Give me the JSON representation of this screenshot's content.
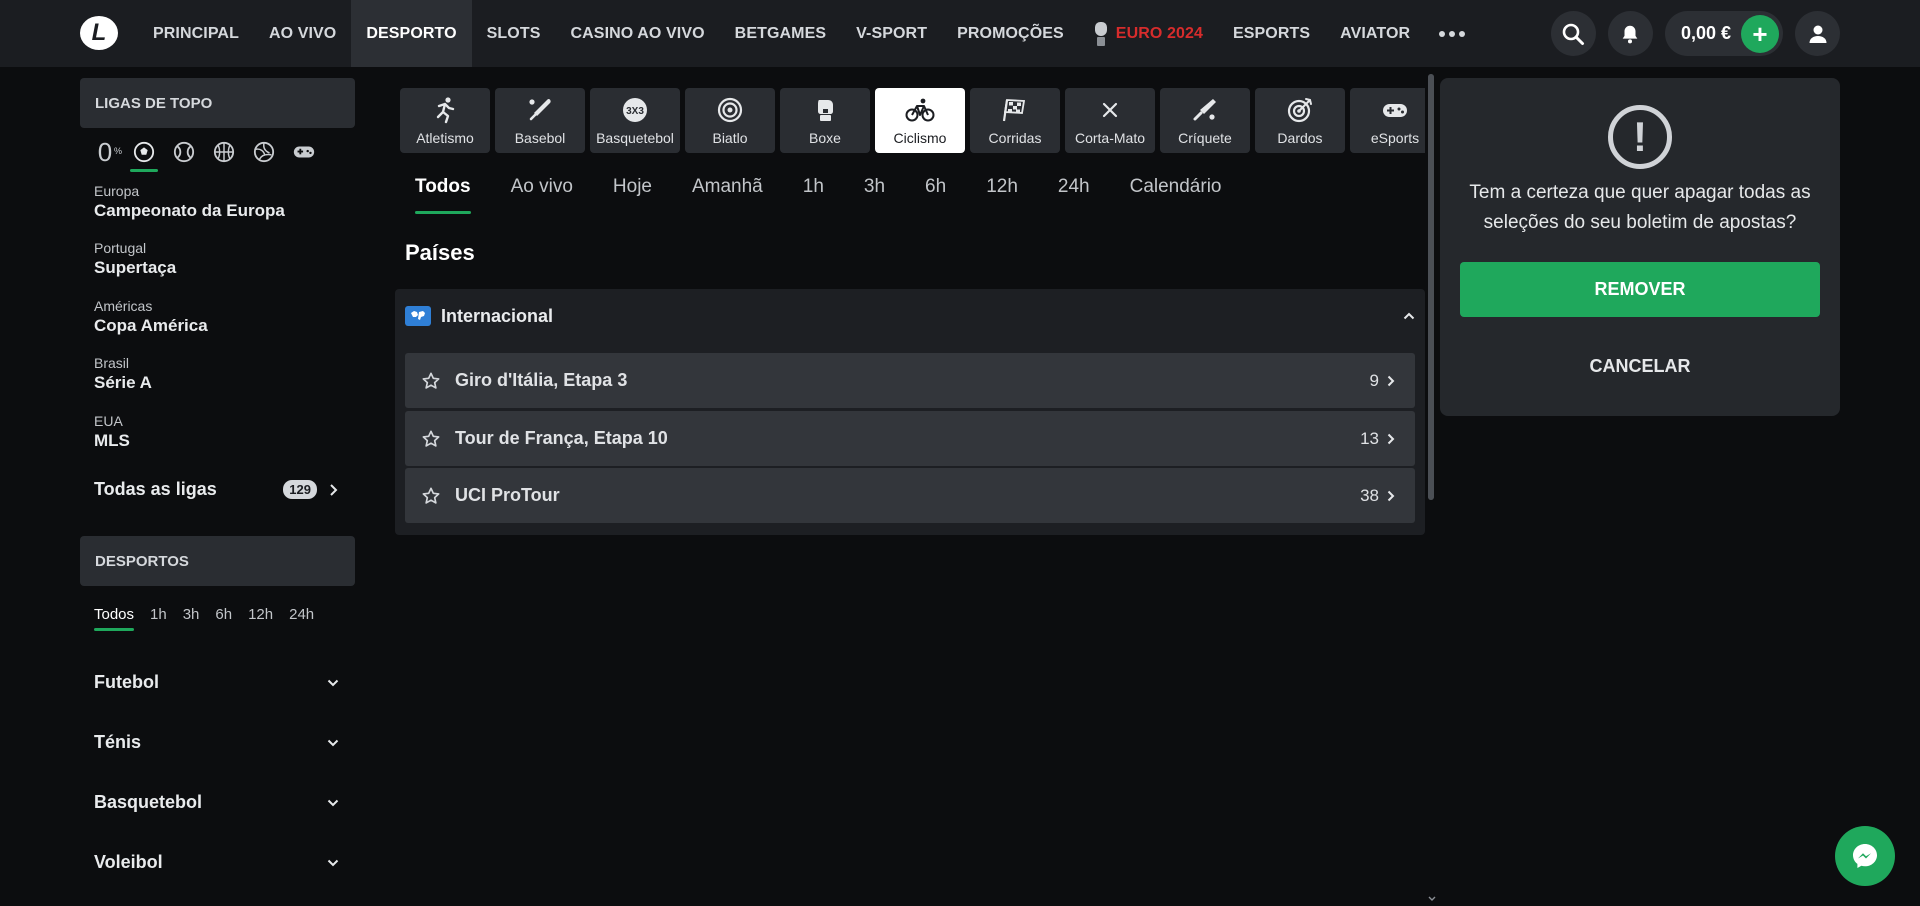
{
  "header": {
    "logo_letter": "L",
    "nav": [
      {
        "label": "PRINCIPAL"
      },
      {
        "label": "AO VIVO"
      },
      {
        "label": "DESPORTO",
        "active": true
      },
      {
        "label": "SLOTS"
      },
      {
        "label": "CASINO AO VIVO"
      },
      {
        "label": "BETGAMES"
      },
      {
        "label": "V-SPORT"
      },
      {
        "label": "PROMOÇÕES"
      },
      {
        "label": "EURO 2024",
        "color": "#d72c2c"
      },
      {
        "label": "ESPORTS"
      },
      {
        "label": "AVIATOR"
      }
    ],
    "balance": "0,00 €",
    "plus": "+"
  },
  "sidebar": {
    "top_leagues_title": "LIGAS DE TOPO",
    "zero_label": "0",
    "zero_sup": "%",
    "leagues": [
      {
        "region": "Europa",
        "name": "Campeonato da Europa"
      },
      {
        "region": "Portugal",
        "name": "Supertaça"
      },
      {
        "region": "Américas",
        "name": "Copa América"
      },
      {
        "region": "Brasil",
        "name": "Série A"
      },
      {
        "region": "EUA",
        "name": "MLS"
      }
    ],
    "all_leagues_label": "Todas as ligas",
    "all_leagues_count": "129",
    "sports_title": "DESPORTOS",
    "time_tabs": [
      "Todos",
      "1h",
      "3h",
      "6h",
      "12h",
      "24h"
    ],
    "sports": [
      "Futebol",
      "Ténis",
      "Basquetebol",
      "Voleibol"
    ]
  },
  "main": {
    "sport_tiles": [
      {
        "label": "Atletismo",
        "icon": "runner-icon"
      },
      {
        "label": "Basebol",
        "icon": "baseball-bat-icon"
      },
      {
        "label": "Basquetebol",
        "icon": "3x3-basketball-icon"
      },
      {
        "label": "Biatlo",
        "icon": "target-icon"
      },
      {
        "label": "Boxe",
        "icon": "boxing-glove-icon"
      },
      {
        "label": "Ciclismo",
        "icon": "bicycle-icon",
        "active": true
      },
      {
        "label": "Corridas",
        "icon": "checkered-flag-icon"
      },
      {
        "label": "Corta-Mato",
        "icon": "cross-icon"
      },
      {
        "label": "Críquete",
        "icon": "cricket-bat-icon"
      },
      {
        "label": "Dardos",
        "icon": "dartboard-icon"
      },
      {
        "label": "eSports",
        "icon": "gamepad-icon"
      }
    ],
    "filter_tabs": [
      "Todos",
      "Ao vivo",
      "Hoje",
      "Amanhã",
      "1h",
      "3h",
      "6h",
      "12h",
      "24h",
      "Calendário"
    ],
    "section_title": "Países",
    "country": {
      "name": "Internacional",
      "competitions": [
        {
          "name": "Giro d'Itália, Etapa 3",
          "count": "9"
        },
        {
          "name": "Tour de França, Etapa 10",
          "count": "13"
        },
        {
          "name": "UCI ProTour",
          "count": "38"
        }
      ]
    }
  },
  "dialog": {
    "icon": "!",
    "message": "Tem a certeza que quer apagar todas as seleções do seu boletim de apostas?",
    "confirm_label": "REMOVER",
    "cancel_label": "CANCELAR"
  },
  "colors": {
    "accent_green": "#1fa85c",
    "euro_red": "#d72c2c",
    "topbar_bg": "#1b1d21",
    "page_bg": "#0c0d0f"
  }
}
